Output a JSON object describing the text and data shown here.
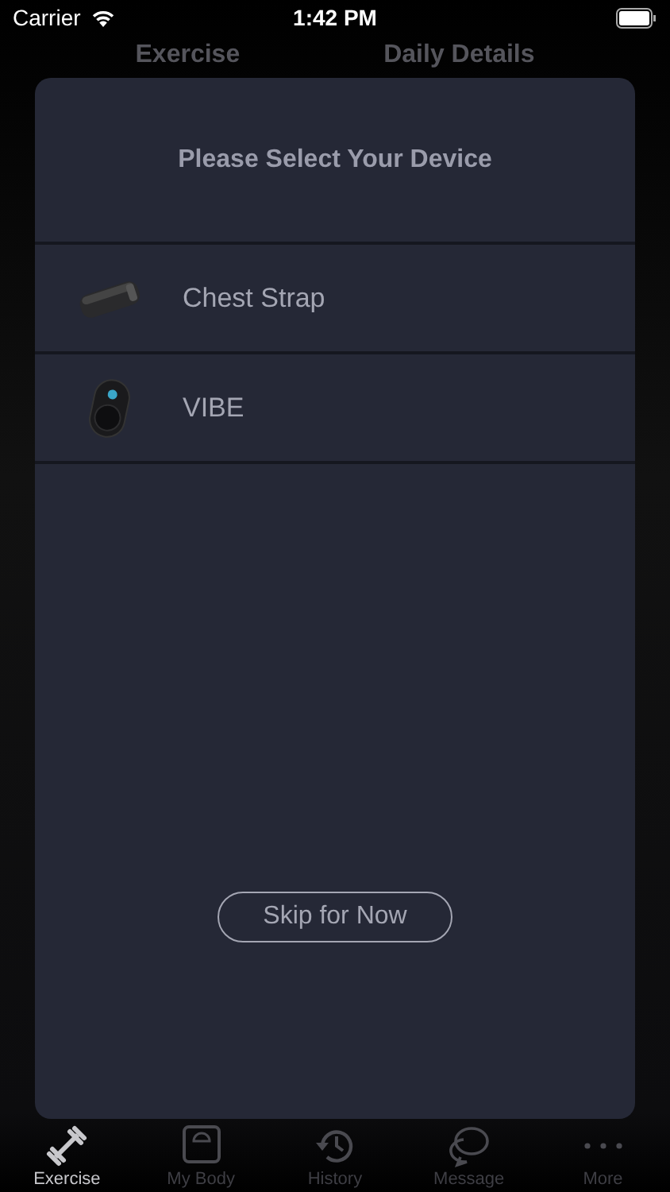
{
  "status_bar": {
    "carrier": "Carrier",
    "time": "1:42 PM"
  },
  "header_tabs": [
    {
      "label": "Exercise"
    },
    {
      "label": "Daily Details"
    }
  ],
  "dialog": {
    "title": "Please Select Your Device",
    "devices": [
      {
        "name": "Chest Strap",
        "kind": "strap"
      },
      {
        "name": "VIBE",
        "kind": "pod"
      }
    ],
    "skip_button": "Skip for Now"
  },
  "tab_bar": [
    {
      "label": "Exercise",
      "kind": "dumbbell",
      "selected": true
    },
    {
      "label": "My Body",
      "kind": "scale",
      "selected": false
    },
    {
      "label": "History",
      "kind": "history",
      "selected": false
    },
    {
      "label": "Message",
      "kind": "chat",
      "selected": false
    },
    {
      "label": "More",
      "kind": "more",
      "selected": false
    }
  ]
}
